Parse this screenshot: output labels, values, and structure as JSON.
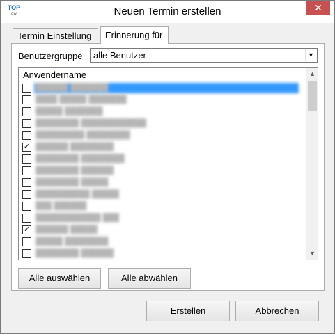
{
  "window": {
    "title": "Neuen Termin erstellen",
    "logo_top": "TOP",
    "logo_sub": "qw",
    "close_symbol": "✕"
  },
  "tabs": [
    {
      "label": "Termin Einstellung",
      "active": false
    },
    {
      "label": "Erinnerung für",
      "active": true
    }
  ],
  "group": {
    "label": "Benutzergruppe",
    "selected": "alle Benutzer"
  },
  "list": {
    "column_header": "Anwendername",
    "rows": [
      {
        "checked": false,
        "selected": true,
        "name": "██████ ███████"
      },
      {
        "checked": false,
        "selected": false,
        "name": "████ █████ ███████"
      },
      {
        "checked": false,
        "selected": false,
        "name": "█████ ███████"
      },
      {
        "checked": false,
        "selected": false,
        "name": "████████ ████████████"
      },
      {
        "checked": false,
        "selected": false,
        "name": "█████████ ████████"
      },
      {
        "checked": true,
        "selected": false,
        "name": "██████ ████████"
      },
      {
        "checked": false,
        "selected": false,
        "name": "████████ ████████"
      },
      {
        "checked": false,
        "selected": false,
        "name": "████████ ██████"
      },
      {
        "checked": false,
        "selected": false,
        "name": "████████ █████"
      },
      {
        "checked": false,
        "selected": false,
        "name": "██████████ █████"
      },
      {
        "checked": false,
        "selected": false,
        "name": "███ ██████"
      },
      {
        "checked": false,
        "selected": false,
        "name": "████████████ ███"
      },
      {
        "checked": true,
        "selected": false,
        "name": "██████ █████"
      },
      {
        "checked": false,
        "selected": false,
        "name": "█████ ████████"
      },
      {
        "checked": false,
        "selected": false,
        "name": "████████ ██████"
      }
    ]
  },
  "buttons": {
    "select_all": "Alle auswählen",
    "deselect_all": "Alle abwählen",
    "create": "Erstellen",
    "cancel": "Abbrechen"
  }
}
